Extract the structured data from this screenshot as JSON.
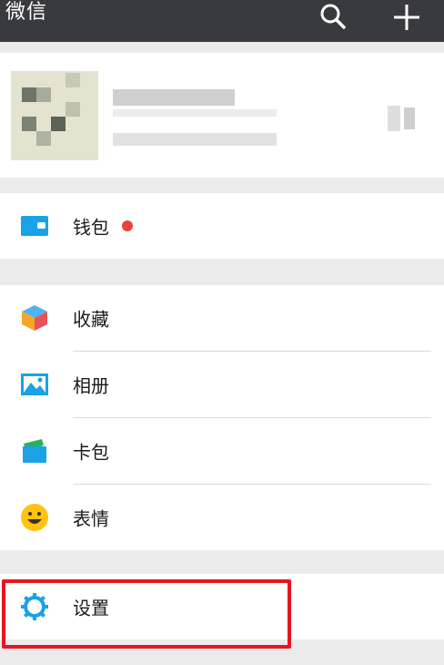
{
  "header": {
    "title": "微信",
    "icons": [
      "search-icon",
      "plus-icon"
    ]
  },
  "wallet": {
    "label": "钱包"
  },
  "menu": [
    {
      "label": "收藏",
      "icon": "favorites-cube-icon"
    },
    {
      "label": "相册",
      "icon": "album-icon"
    },
    {
      "label": "卡包",
      "icon": "card-pack-icon"
    },
    {
      "label": "表情",
      "icon": "sticker-smile-icon"
    }
  ],
  "settings": {
    "label": "设置",
    "icon": "gear-icon"
  },
  "colors": {
    "topbar": "#393a3f",
    "accent_blue": "#1aa2e6",
    "badge_red": "#e64340",
    "highlight_red": "#e8151e"
  }
}
